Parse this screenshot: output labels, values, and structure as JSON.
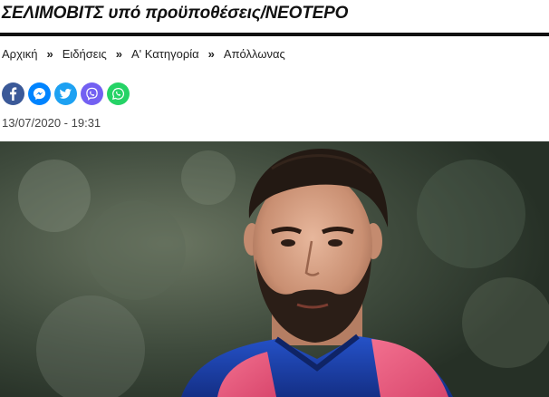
{
  "article": {
    "headline": "ΣΕΛΙΜΟΒΙΤΣ υπό προϋποθέσεις/ΝΕΟΤΕΡΟ",
    "date": "13/07/2020 - 19:31"
  },
  "breadcrumb": {
    "items": [
      "Αρχική",
      "Ειδήσεις",
      "Α' Κατηγορία",
      "Απόλλωνας"
    ],
    "separator": "»"
  },
  "share": {
    "buttons": [
      {
        "icon": "facebook-icon",
        "color": "#3b5998"
      },
      {
        "icon": "messenger-icon",
        "color": "#0084ff"
      },
      {
        "icon": "twitter-icon",
        "color": "#1da1f2"
      },
      {
        "icon": "viber-icon",
        "color": "#7360f2"
      },
      {
        "icon": "whatsapp-icon",
        "color": "#25d366"
      }
    ]
  },
  "colors": {
    "rule": "#111111",
    "pink_bib": "#e8557a",
    "blue_jersey": "#1a3fa8"
  }
}
